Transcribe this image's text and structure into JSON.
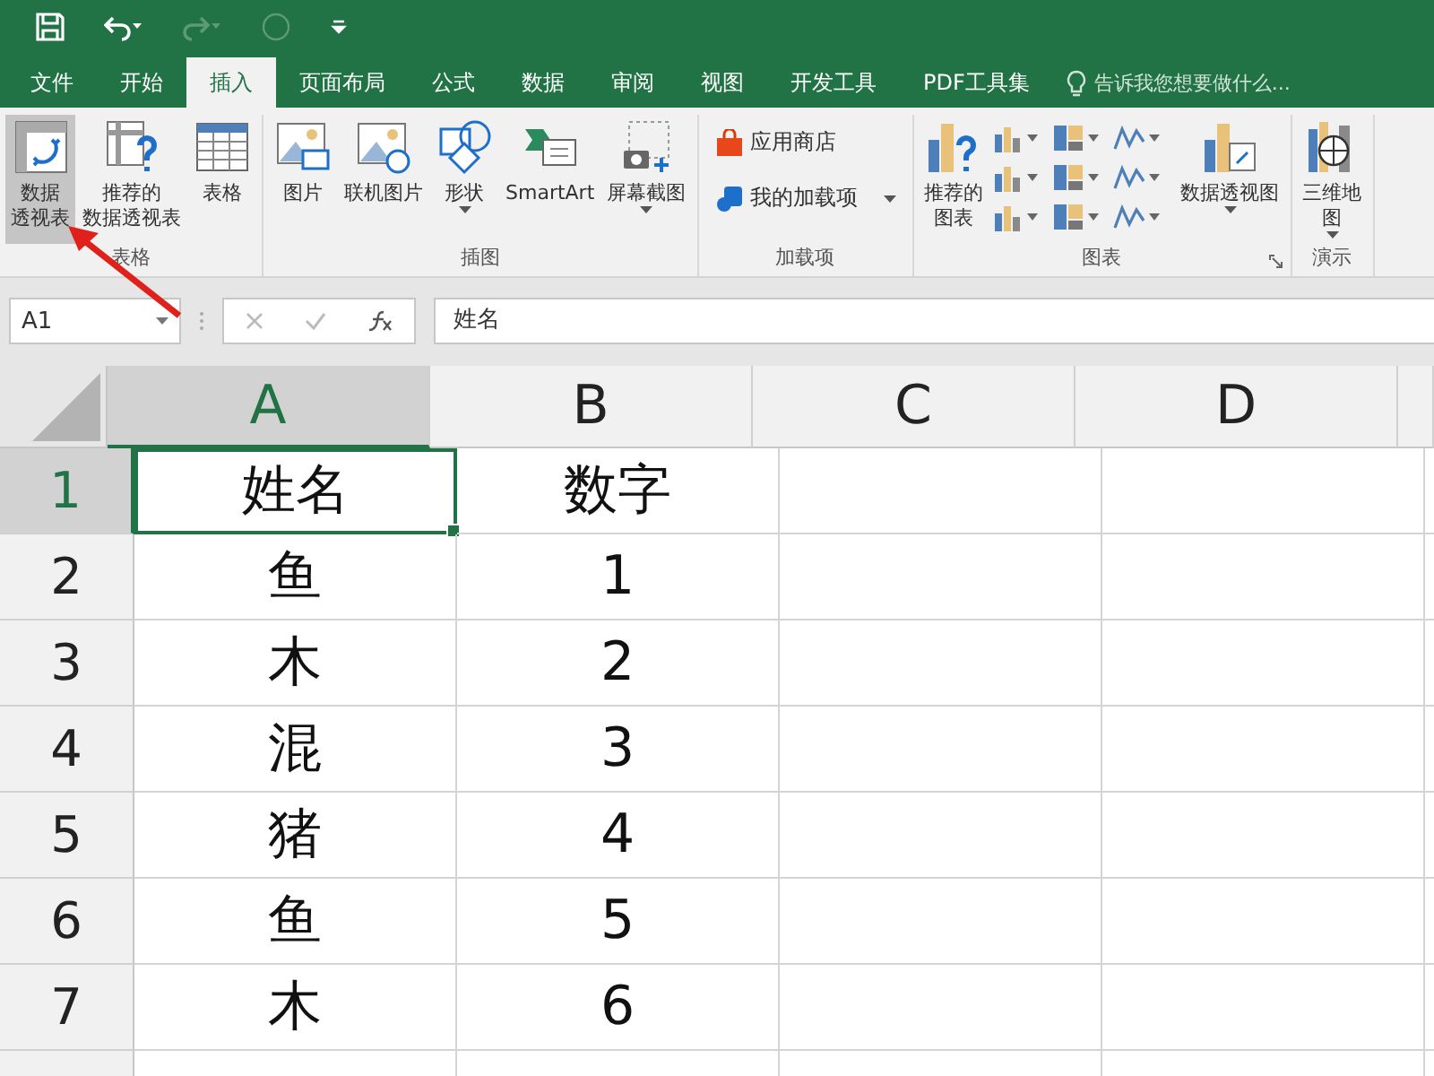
{
  "tabs": [
    {
      "label": "文件",
      "selected": false
    },
    {
      "label": "开始",
      "selected": false
    },
    {
      "label": "插入",
      "selected": true
    },
    {
      "label": "页面布局",
      "selected": false
    },
    {
      "label": "公式",
      "selected": false
    },
    {
      "label": "数据",
      "selected": false
    },
    {
      "label": "审阅",
      "selected": false
    },
    {
      "label": "视图",
      "selected": false
    },
    {
      "label": "开发工具",
      "selected": false
    },
    {
      "label": "PDF工具集",
      "selected": false
    }
  ],
  "tell_me": {
    "placeholder": "告诉我您想要做什么..."
  },
  "ribbon": {
    "groups": [
      {
        "label": "表格",
        "kind": "large",
        "buttons": [
          {
            "label_lines": [
              "数据",
              "透视表"
            ],
            "selected": true,
            "dropdown": false
          },
          {
            "label_lines": [
              "推荐的",
              "数据透视表"
            ],
            "selected": false,
            "dropdown": false
          },
          {
            "label_lines": [
              "表格"
            ],
            "selected": false,
            "dropdown": false
          }
        ]
      },
      {
        "label": "插图",
        "kind": "large",
        "buttons": [
          {
            "label_lines": [
              "图片"
            ],
            "selected": false,
            "dropdown": false
          },
          {
            "label_lines": [
              "联机图片"
            ],
            "selected": false,
            "dropdown": false
          },
          {
            "label_lines": [
              "形状"
            ],
            "selected": false,
            "dropdown": true
          },
          {
            "label_lines": [
              "SmartArt"
            ],
            "selected": false,
            "dropdown": false
          },
          {
            "label_lines": [
              "屏幕截图"
            ],
            "selected": false,
            "dropdown": true
          }
        ]
      },
      {
        "label": "加载项",
        "kind": "small",
        "buttons": [
          {
            "label_lines": [
              "应用商店"
            ],
            "selected": false,
            "dropdown": false
          },
          {
            "label_lines": [
              "我的加载项"
            ],
            "selected": false,
            "dropdown": true
          }
        ]
      },
      {
        "label": "图表",
        "kind": "charts",
        "buttons": [
          {
            "label_lines": [
              "推荐的",
              "图表"
            ],
            "selected": false,
            "dropdown": false
          },
          {
            "label_lines": [
              "数据透视图"
            ],
            "selected": false,
            "dropdown": true
          }
        ]
      },
      {
        "label": "演示",
        "kind": "large",
        "buttons": [
          {
            "label_lines": [
              "三维地",
              "图"
            ],
            "selected": false,
            "dropdown": true
          }
        ]
      }
    ]
  },
  "formula_bar": {
    "name_box": "A1",
    "formula": "姓名"
  },
  "sheet": {
    "columns": [
      {
        "label": "A",
        "selected": true
      },
      {
        "label": "B",
        "selected": false
      },
      {
        "label": "C",
        "selected": false
      },
      {
        "label": "D",
        "selected": false
      }
    ],
    "rows": [
      {
        "label": "1",
        "selected": true,
        "cells": [
          "姓名",
          "数字"
        ]
      },
      {
        "label": "2",
        "selected": false,
        "cells": [
          "鱼",
          "1"
        ]
      },
      {
        "label": "3",
        "selected": false,
        "cells": [
          "木",
          "2"
        ]
      },
      {
        "label": "4",
        "selected": false,
        "cells": [
          "混",
          "3"
        ]
      },
      {
        "label": "5",
        "selected": false,
        "cells": [
          "猪",
          "4"
        ]
      },
      {
        "label": "6",
        "selected": false,
        "cells": [
          "鱼",
          "5"
        ]
      },
      {
        "label": "7",
        "selected": false,
        "cells": [
          "木",
          "6"
        ]
      }
    ]
  }
}
